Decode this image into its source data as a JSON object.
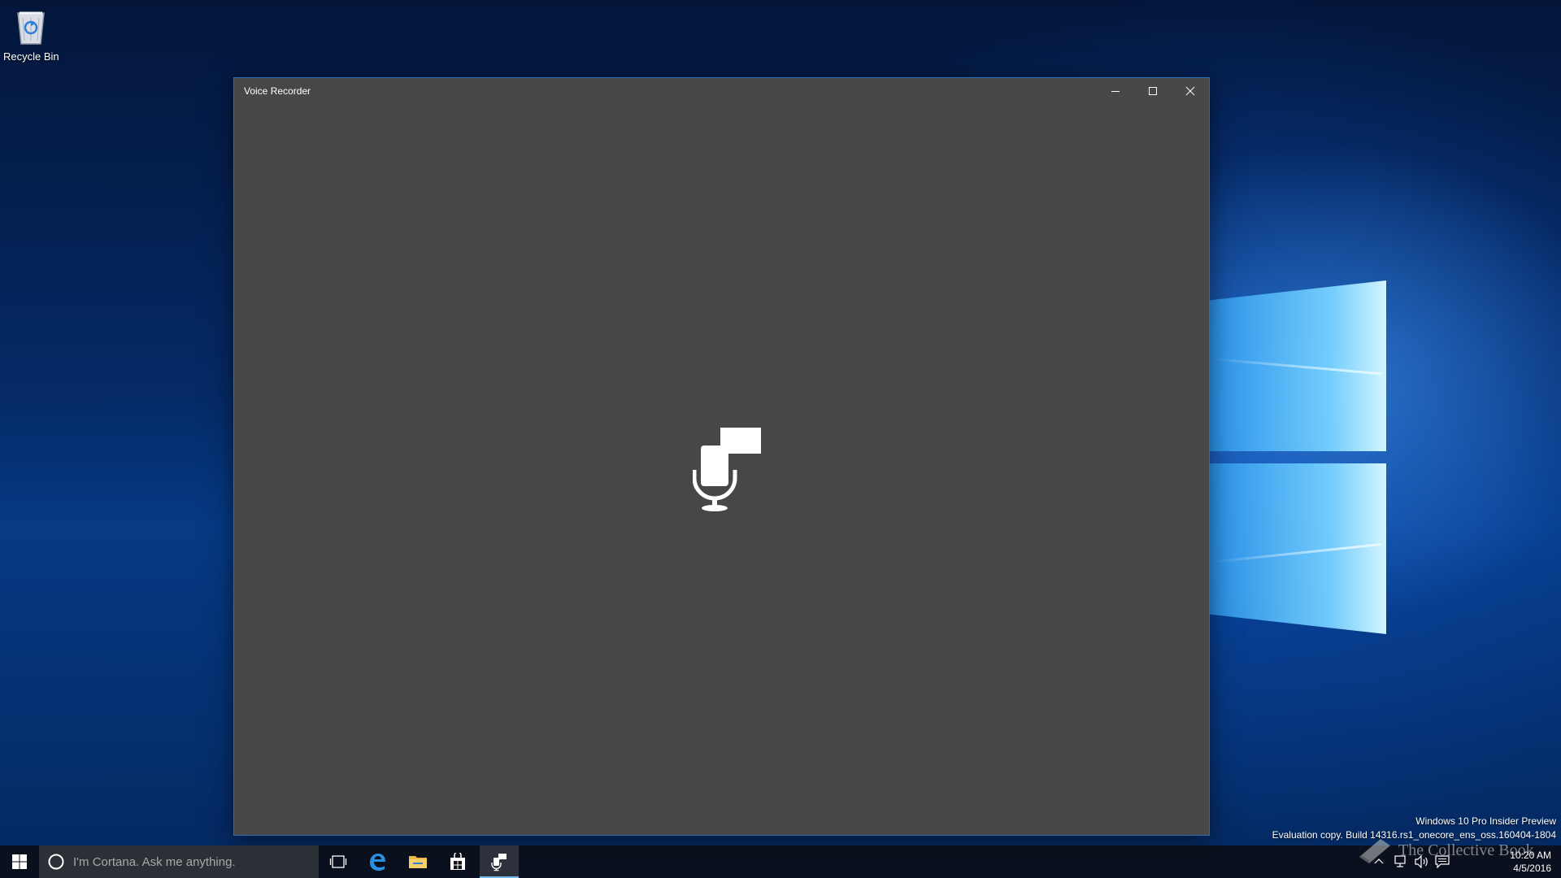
{
  "desktop": {
    "icons": [
      {
        "label": "Recycle Bin",
        "icon": "recycle-bin-icon"
      }
    ],
    "watermark": {
      "line1": "Windows 10 Pro Insider Preview",
      "line2": "Evaluation copy. Build 14316.rs1_onecore_ens_oss.160404-1804"
    },
    "overlay_logo_text": "The Collective Book"
  },
  "window": {
    "title": "Voice Recorder",
    "controls": [
      "minimize-icon",
      "maximize-icon",
      "close-icon"
    ],
    "content_icon": "voice-recorder-logo-icon",
    "background_color": "#474747",
    "border_color": "#2b6fb8"
  },
  "taskbar": {
    "search_placeholder": "I'm Cortana. Ask me anything.",
    "pinned": [
      {
        "name": "task-view",
        "icon": "task-view-icon"
      },
      {
        "name": "edge",
        "icon": "edge-icon"
      },
      {
        "name": "file-explorer",
        "icon": "folder-icon"
      },
      {
        "name": "store",
        "icon": "store-icon"
      },
      {
        "name": "voice-recorder",
        "icon": "voice-recorder-icon",
        "active": true
      }
    ],
    "tray_icons": [
      "chevron-up-icon",
      "network-icon",
      "volume-icon",
      "notification-icon"
    ],
    "clock": {
      "time": "10:20 AM",
      "date": "4/5/2016"
    }
  }
}
